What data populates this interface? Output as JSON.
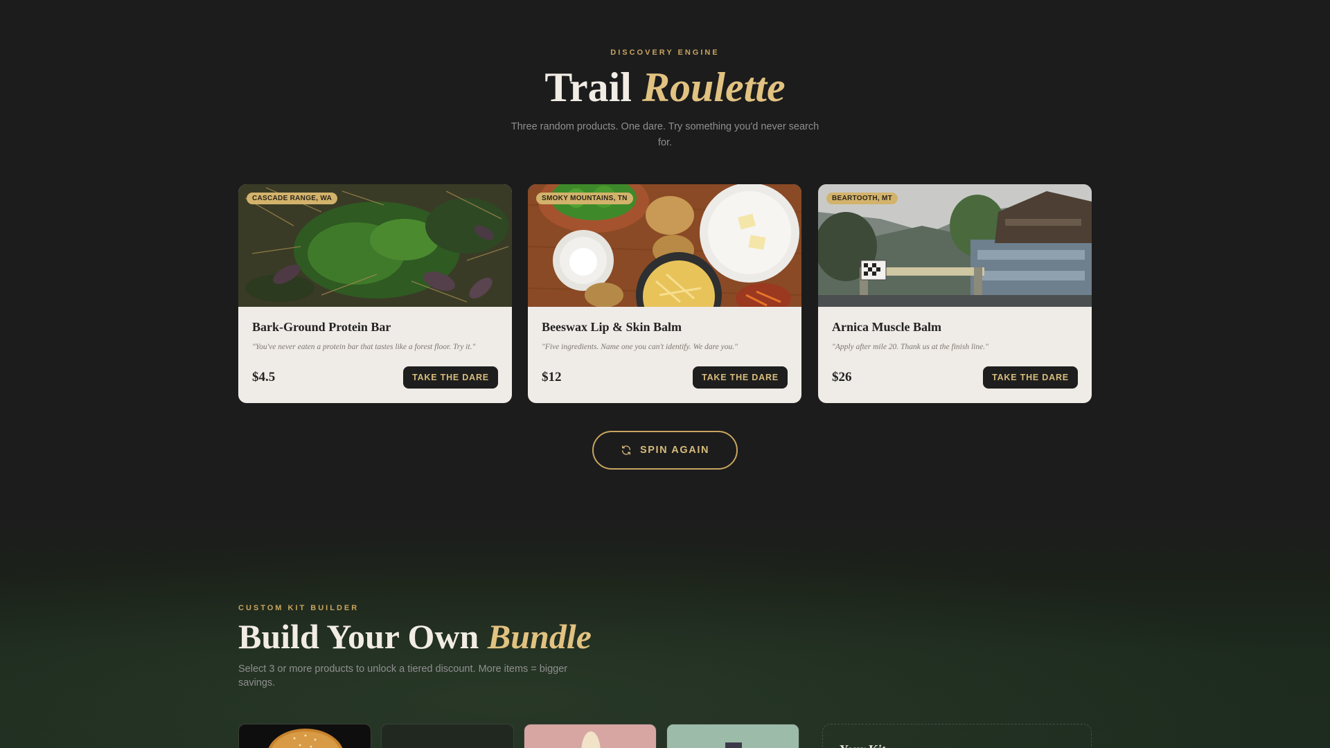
{
  "roulette": {
    "eyebrow": "DISCOVERY ENGINE",
    "title_plain": "Trail",
    "title_accent": "Roulette",
    "subtitle": "Three random products. One dare. Try something you'd never search for.",
    "cards": [
      {
        "tag": "CASCADE RANGE, WA",
        "title": "Bark-Ground Protein Bar",
        "quote": "\"You've never eaten a protein bar that tastes like a forest floor. Try it.\"",
        "price": "$4.5",
        "button": "TAKE THE DARE",
        "image": "forest-floor-moss-photo"
      },
      {
        "tag": "SMOKY MOUNTAINS, TN",
        "title": "Beeswax Lip & Skin Balm",
        "quote": "\"Five ingredients. Name one you can't identify. We dare you.\"",
        "price": "$12",
        "button": "TAKE THE DARE",
        "image": "kitchen-ingredients-photo"
      },
      {
        "tag": "BEARTOOTH, MT",
        "title": "Arnica Muscle Balm",
        "quote": "\"Apply after mile 20. Thank us at the finish line.\"",
        "price": "$26",
        "button": "TAKE THE DARE",
        "image": "mountain-town-finish-line-photo"
      }
    ],
    "spin_button": "SPIN AGAIN",
    "spin_icon": "refresh-icon"
  },
  "kit_builder": {
    "eyebrow": "CUSTOM KIT BUILDER",
    "title_plain": "Build Your Own",
    "title_accent": "Bundle",
    "subtitle": "Select 3 or more products to unlock a tiered discount. More items = bigger savings.",
    "panel_title": "Your Kit"
  },
  "colors": {
    "background": "#1c1c1d",
    "accent": "#c9a55f",
    "card": "#efebe6",
    "tag": "#d3b36c"
  }
}
